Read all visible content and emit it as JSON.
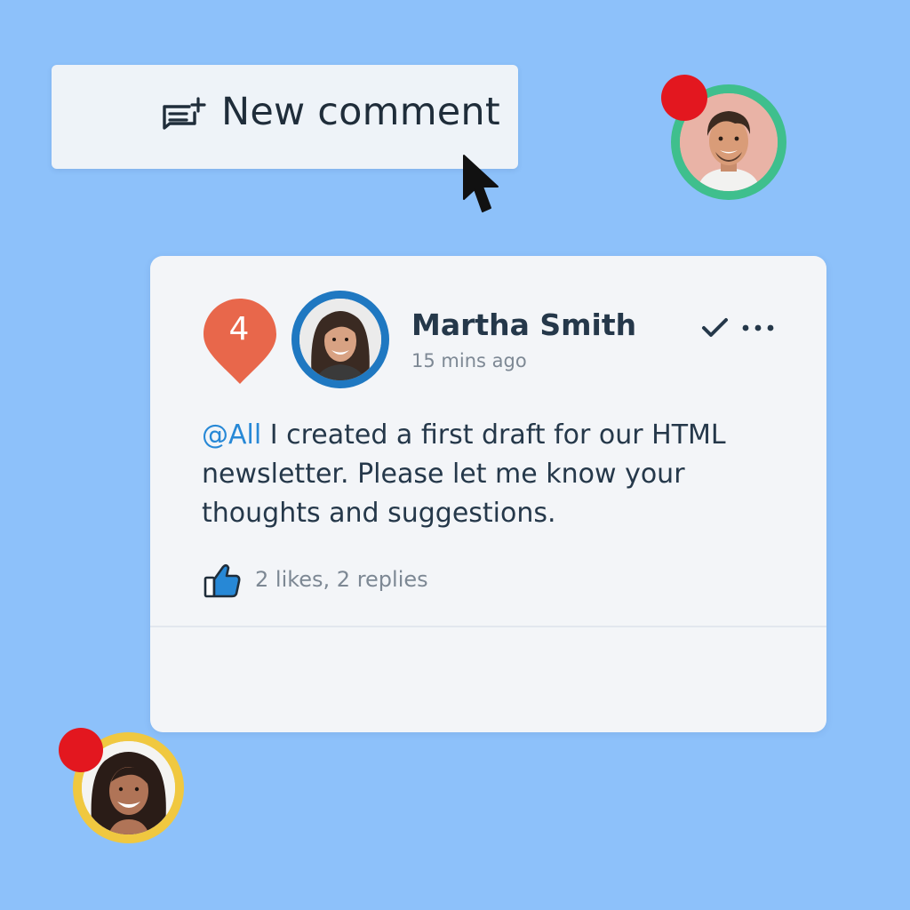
{
  "new_comment_button": {
    "label": "New comment",
    "icon": "comment-add-icon"
  },
  "comment": {
    "unread_count": "4",
    "author": "Martha Smith",
    "timestamp": "15 mins ago",
    "mention": "@All",
    "text": " I created a first draft for our HTML newsletter. Please let me know your thoughts and suggestions.",
    "stats": "2 likes, 2 replies"
  },
  "icons": {
    "resolve": "checkmark-icon",
    "more": "more-horizontal-icon",
    "like": "thumbs-up-icon",
    "cursor": "mouse-pointer-icon"
  },
  "colors": {
    "background": "#8dc1fa",
    "card": "#f3f5f8",
    "accent_blue": "#2788d6",
    "marker_orange": "#e8674b",
    "notification_red": "#e3171f",
    "ring_green": "#3fbf8d",
    "ring_blue": "#1f78c1",
    "ring_yellow": "#f0c840"
  }
}
